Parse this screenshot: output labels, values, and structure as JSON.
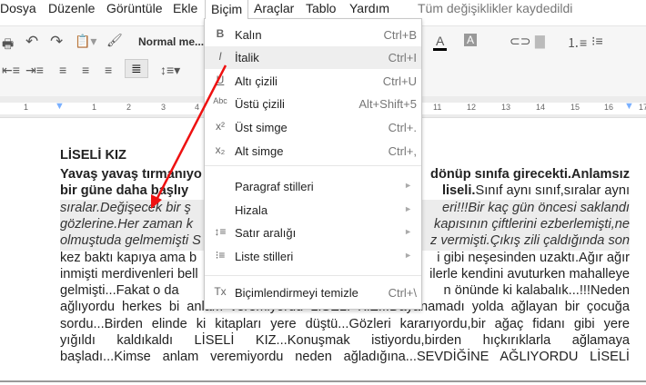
{
  "menubar": {
    "items": [
      "Dosya",
      "Düzenle",
      "Görüntüle",
      "Ekle",
      "Biçim",
      "Araçlar",
      "Tablo",
      "Yardım"
    ],
    "status": "Tüm değişiklikler kaydedildi"
  },
  "toolbar": {
    "style": "Normal me...",
    "zoom_hidden": true
  },
  "ruler": {
    "ticks": [
      "1",
      "1",
      "2",
      "3",
      "4",
      "11",
      "12",
      "13",
      "14",
      "15",
      "16",
      "17"
    ]
  },
  "format_menu": {
    "items": [
      {
        "icon": "bold-icon",
        "glyph": "B",
        "label": "Kalın",
        "shortcut": "Ctrl+B"
      },
      {
        "icon": "italic-icon",
        "glyph": "I",
        "label": "İtalik",
        "shortcut": "Ctrl+I"
      },
      {
        "icon": "underline-icon",
        "glyph": "U",
        "label": "Altı çizili",
        "shortcut": "Ctrl+U"
      },
      {
        "icon": "strikethrough-icon",
        "glyph": "Abc",
        "label": "Üstü çizili",
        "shortcut": "Alt+Shift+5"
      },
      {
        "icon": "superscript-icon",
        "glyph": "x²",
        "label": "Üst simge",
        "shortcut": "Ctrl+."
      },
      {
        "icon": "subscript-icon",
        "glyph": "x₂",
        "label": "Alt simge",
        "shortcut": "Ctrl+,"
      },
      {
        "icon": "",
        "glyph": "",
        "label": "Paragraf stilleri",
        "shortcut": ""
      },
      {
        "icon": "",
        "glyph": "",
        "label": "Hizala",
        "shortcut": ""
      },
      {
        "icon": "line-spacing-icon",
        "glyph": "↕≡",
        "label": "Satır aralığı",
        "shortcut": ""
      },
      {
        "icon": "list-icon",
        "glyph": "⁝≡",
        "label": "Liste stilleri",
        "shortcut": ""
      },
      {
        "icon": "clear-formatting-icon",
        "glyph": "Tx",
        "label": "Biçimlendirmeyi temizle",
        "shortcut": "Ctrl+\\"
      }
    ],
    "highlighted": "İtalik"
  },
  "document": {
    "title": "LİSELİ KIZ",
    "lines": [
      {
        "left": "Yavaş yavaş tırmanıyo",
        "right": "dönüp sınıfa girecekti.Anlamsız"
      },
      {
        "left": "bir güne daha başlıy",
        "right_bold": "liseli.",
        "right": "Sınıf aynı sınıf,sıralar aynı"
      },
      {
        "left": "sıralar.Değişecek bir ş",
        "right": "eri!!!Bir kaç gün öncesi saklandı"
      },
      {
        "left": "gözlerine.Her zaman k",
        "right": "kapısının çiftlerini ezberlemişti,ne"
      },
      {
        "left": "olmuştuda gelmemişti S",
        "right": "z vermişti.Çıkış zili çaldığında son"
      },
      {
        "left": "kez baktı kapıya ama b",
        "right": "i gibi neşesinden uzaktı.Ağır ağır"
      },
      {
        "left": "inmişti merdivenleri bell",
        "right": "ilerle kendini avuturken mahalleye"
      },
      {
        "left": "gelmişti...Fakat o da",
        "right": "n önünde ki kalabalık...!!!Neden"
      }
    ],
    "full_lines": [
      "ağlıyordu herkes bi anlam veremiyordu LİSELİ KIZ...Dayanamadı yolda ağlayan bir çocuğa",
      "sordu...Birden elinde ki kitapları yere düştü...Gözleri kararıyordu,bir ağaç fidanı gibi yere",
      "yığıldı kaldıkaldı LİSELİ KIZ...Konuşmak istiyordu,birden hıçkırıklarla ağlamaya",
      "başladı...Kimse anlam veremiyordu neden ağladığına...SEVDİĞİNE AĞLIYORDU LİSELİ"
    ]
  },
  "annotation": {
    "arrow_color": "#ee1111"
  }
}
